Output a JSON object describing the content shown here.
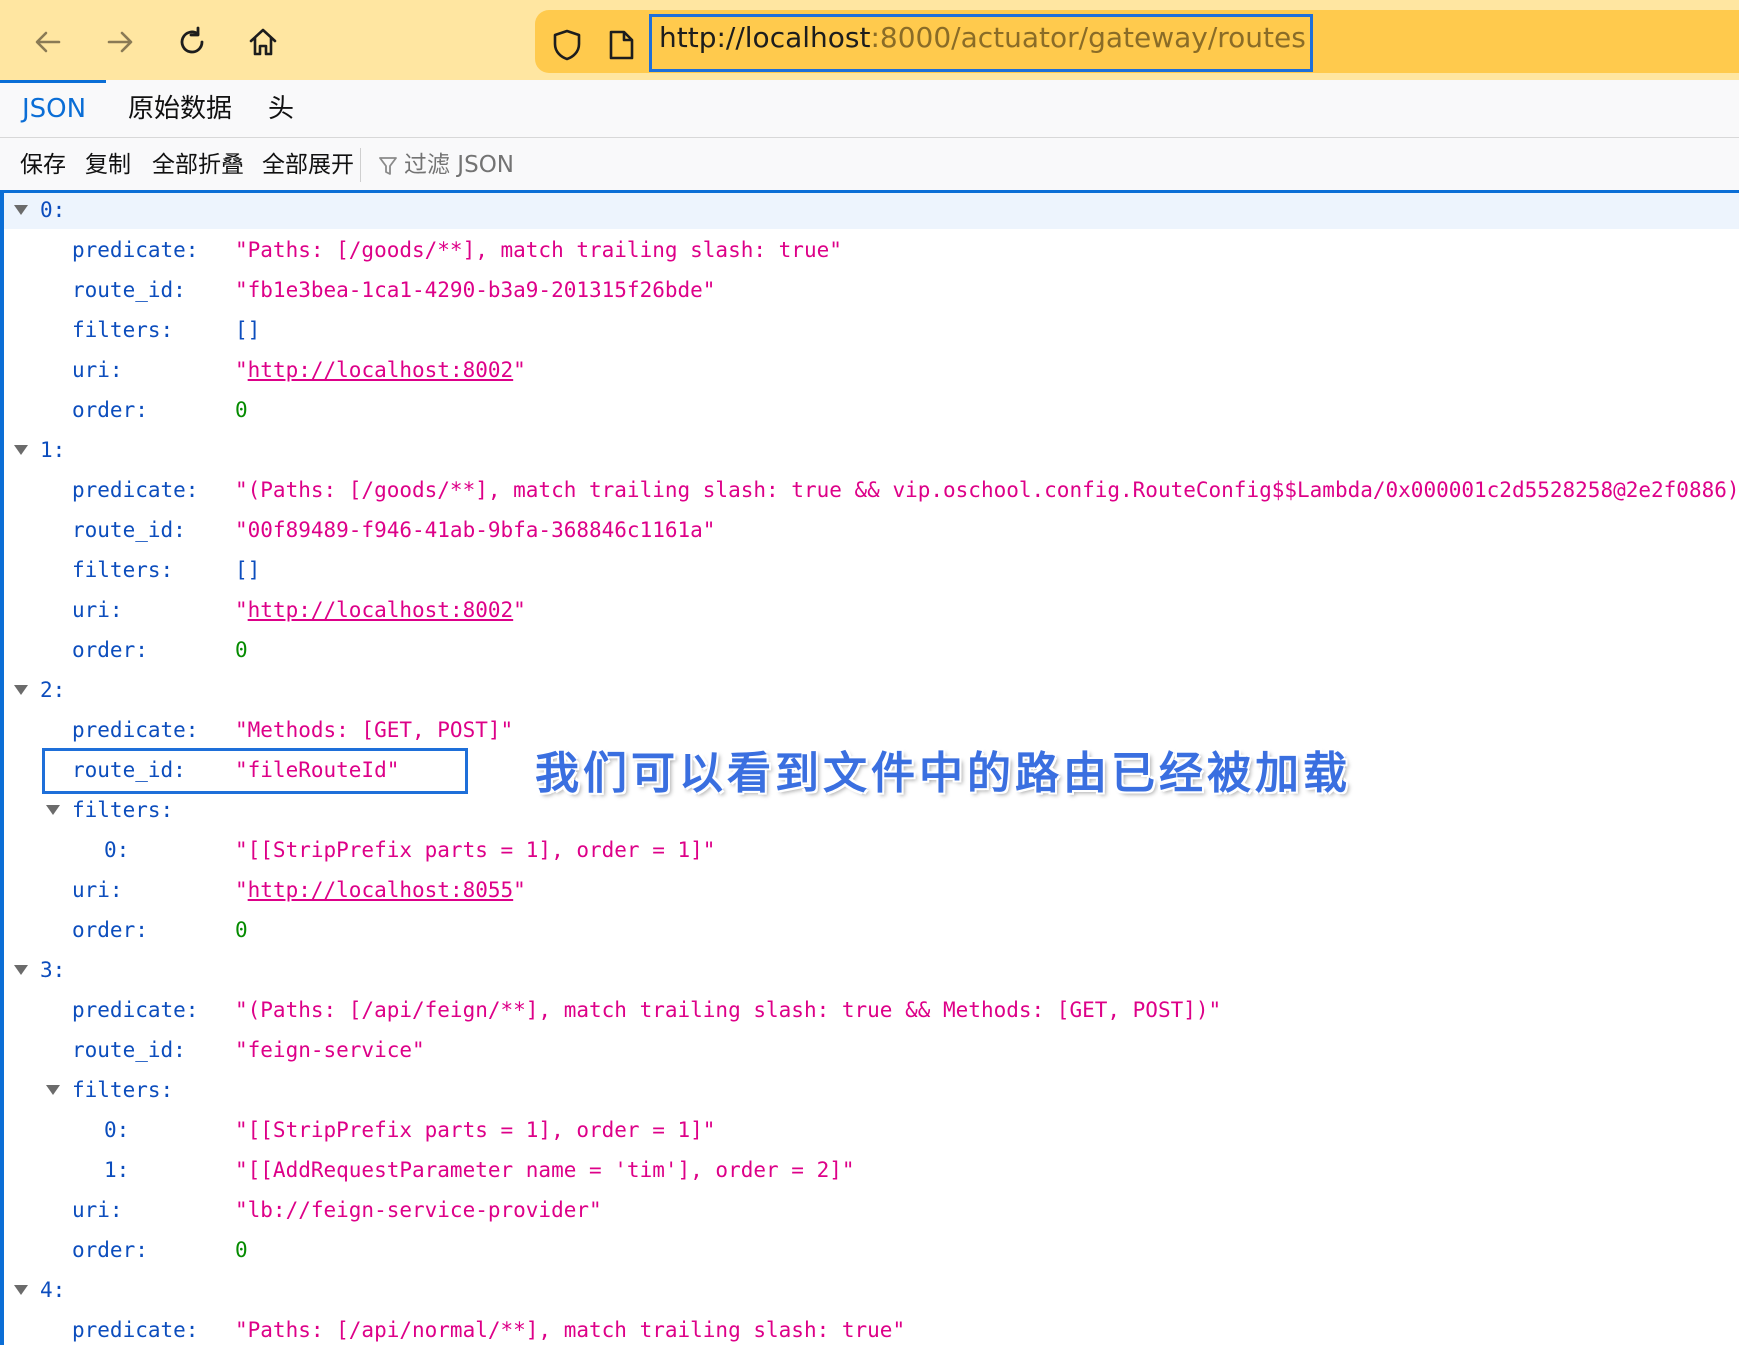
{
  "browser": {
    "url_host": "http://localhost",
    "url_rest": ":8000/actuator/gateway/routes"
  },
  "tabs": [
    "JSON",
    "原始数据",
    "头"
  ],
  "toolbar": {
    "save": "保存",
    "copy": "复制",
    "collapse_all": "全部折叠",
    "expand_all": "全部展开",
    "filter_placeholder": "过滤 JSON"
  },
  "rows": [
    {
      "type": "index",
      "key": "0:"
    },
    {
      "type": "prop",
      "key": "predicate:",
      "value": "\"Paths: [/goods/**], match trailing slash: true\"",
      "vtype": "str"
    },
    {
      "type": "prop",
      "key": "route_id:",
      "value": "\"fb1e3bea-1ca1-4290-b3a9-201315f26bde\"",
      "vtype": "str"
    },
    {
      "type": "prop",
      "key": "filters:",
      "value": "[]",
      "vtype": "arr"
    },
    {
      "type": "link",
      "key": "uri:",
      "link": "http://localhost:8002"
    },
    {
      "type": "prop",
      "key": "order:",
      "value": "0",
      "vtype": "num"
    },
    {
      "type": "index",
      "key": "1:"
    },
    {
      "type": "prop",
      "key": "predicate:",
      "value": "\"(Paths: [/goods/**], match trailing slash: true && vip.oschool.config.RouteConfig$$Lambda/0x000001c2d5528258@2e2f0886)\"",
      "vtype": "str"
    },
    {
      "type": "prop",
      "key": "route_id:",
      "value": "\"00f89489-f946-41ab-9bfa-368846c1161a\"",
      "vtype": "str"
    },
    {
      "type": "prop",
      "key": "filters:",
      "value": "[]",
      "vtype": "arr"
    },
    {
      "type": "link",
      "key": "uri:",
      "link": "http://localhost:8002"
    },
    {
      "type": "prop",
      "key": "order:",
      "value": "0",
      "vtype": "num"
    },
    {
      "type": "index",
      "key": "2:"
    },
    {
      "type": "prop",
      "key": "predicate:",
      "value": "\"Methods: [GET, POST]\"",
      "vtype": "str"
    },
    {
      "type": "prop",
      "key": "route_id:",
      "value": "\"fileRouteId\"",
      "vtype": "str"
    },
    {
      "type": "group",
      "key": "filters:"
    },
    {
      "type": "sub",
      "key": "0:",
      "value": "\"[[StripPrefix parts = 1], order = 1]\"",
      "vtype": "str"
    },
    {
      "type": "link",
      "key": "uri:",
      "link": "http://localhost:8055"
    },
    {
      "type": "prop",
      "key": "order:",
      "value": "0",
      "vtype": "num"
    },
    {
      "type": "index",
      "key": "3:"
    },
    {
      "type": "prop",
      "key": "predicate:",
      "value": "\"(Paths: [/api/feign/**], match trailing slash: true && Methods: [GET, POST])\"",
      "vtype": "str"
    },
    {
      "type": "prop",
      "key": "route_id:",
      "value": "\"feign-service\"",
      "vtype": "str"
    },
    {
      "type": "group",
      "key": "filters:"
    },
    {
      "type": "sub",
      "key": "0:",
      "value": "\"[[StripPrefix parts = 1], order = 1]\"",
      "vtype": "str"
    },
    {
      "type": "sub",
      "key": "1:",
      "value": "\"[[AddRequestParameter name = 'tim'], order = 2]\"",
      "vtype": "str"
    },
    {
      "type": "prop",
      "key": "uri:",
      "value": "\"lb://feign-service-provider\"",
      "vtype": "str"
    },
    {
      "type": "prop",
      "key": "order:",
      "value": "0",
      "vtype": "num"
    },
    {
      "type": "index",
      "key": "4:"
    },
    {
      "type": "prop",
      "key": "predicate:",
      "value": "\"Paths: [/api/normal/**], match trailing slash: true\"",
      "vtype": "str"
    }
  ],
  "annotation": "我们可以看到文件中的路由已经被加载"
}
